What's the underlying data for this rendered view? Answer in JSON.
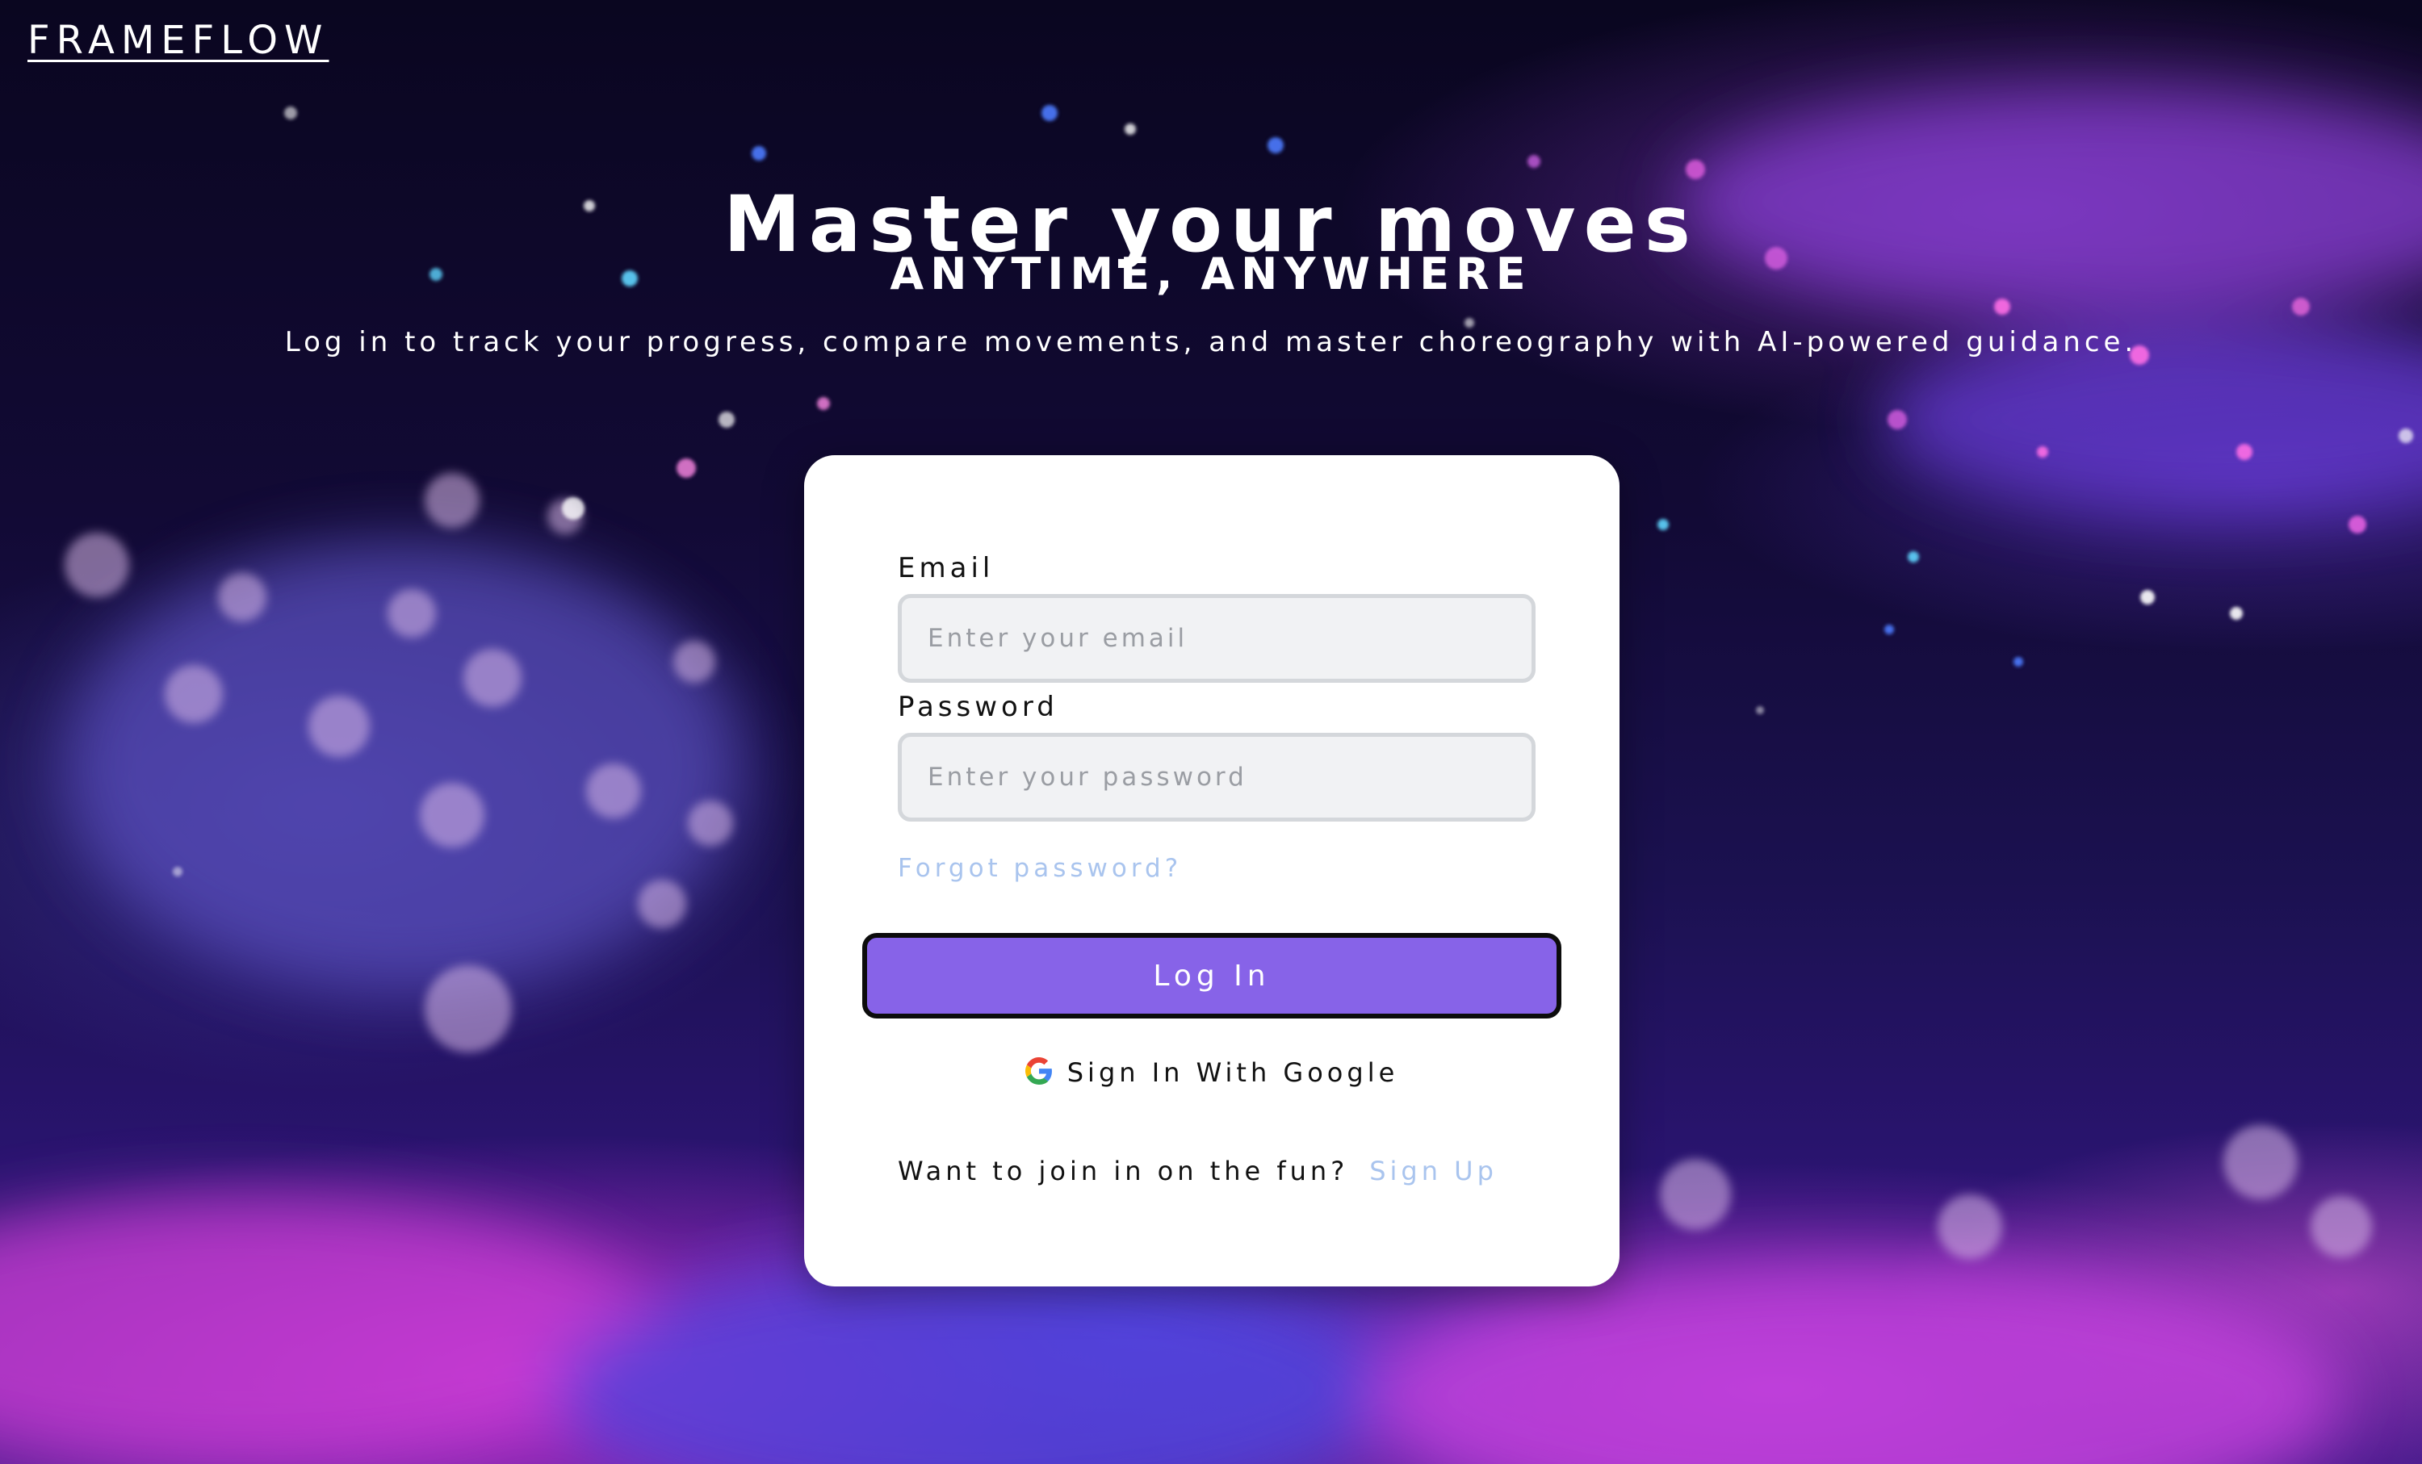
{
  "brand": {
    "logo_text": "FRAMEFLOW"
  },
  "hero": {
    "title": "Master your moves",
    "subtitle": "ANYTIME, ANYWHERE",
    "description": "Log in to track your progress, compare movements, and master choreography with AI-powered guidance."
  },
  "login_form": {
    "email_label": "Email",
    "email_placeholder": "Enter your email",
    "email_value": "",
    "password_label": "Password",
    "password_placeholder": "Enter your password",
    "password_value": "",
    "forgot_password": "Forgot password?",
    "login_button": "Log In",
    "google_button": "Sign In With Google",
    "google_icon": "google-g-icon",
    "signup_prompt": "Want to join in on the fun?",
    "signup_link": "Sign Up"
  },
  "colors": {
    "primary_button": "#8763e8",
    "link": "#a9c4ee",
    "input_bg": "#f1f2f4",
    "card_bg": "#ffffff"
  }
}
